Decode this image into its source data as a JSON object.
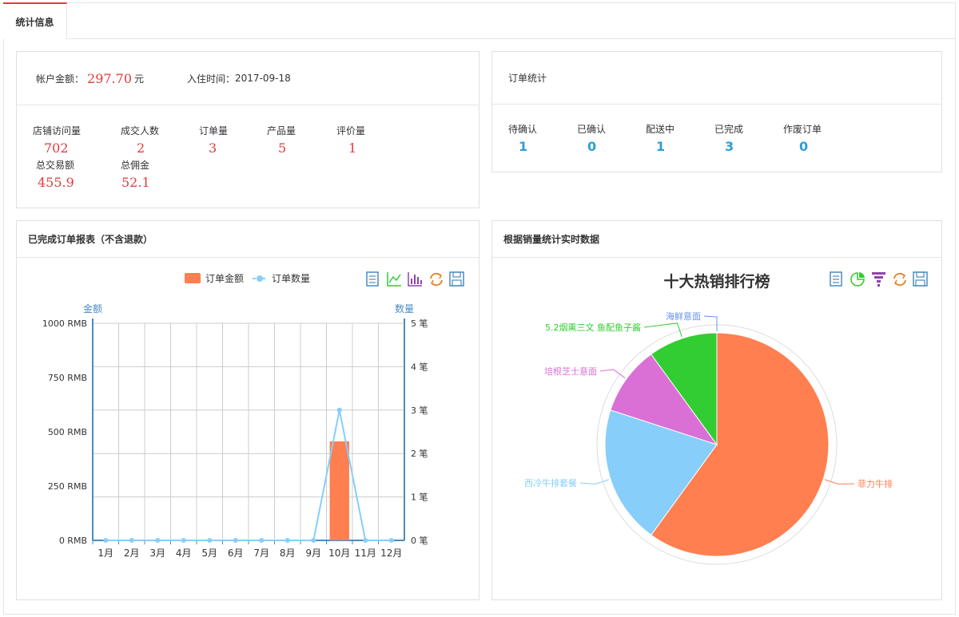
{
  "tab": {
    "label": "统计信息"
  },
  "account": {
    "balance_label": "帐户金额：",
    "balance_value": "297.70",
    "balance_unit": "元",
    "join_label": "入住时间：",
    "join_value": "2017-09-18"
  },
  "shop_stats": [
    {
      "label": "店铺访问量",
      "value": "702"
    },
    {
      "label": "成交人数",
      "value": "2"
    },
    {
      "label": "订单量",
      "value": "3"
    },
    {
      "label": "产品量",
      "value": "5"
    },
    {
      "label": "评价量",
      "value": "1"
    },
    {
      "label": "总交易额",
      "value": "455.9"
    },
    {
      "label": "总佣金",
      "value": "52.1"
    }
  ],
  "order_stats": {
    "title": "订单统计",
    "items": [
      {
        "label": "待确认",
        "value": "1"
      },
      {
        "label": "已确认",
        "value": "0"
      },
      {
        "label": "配送中",
        "value": "1"
      },
      {
        "label": "已完成",
        "value": "3"
      },
      {
        "label": "作废订单",
        "value": "0"
      }
    ]
  },
  "report_panel": {
    "title": "已完成订单报表（不含退款）"
  },
  "sales_panel": {
    "title": "根据销量统计实时数据"
  },
  "colors": {
    "accent": "#e4393c",
    "bar": "#ff7f50",
    "line": "#87cefa",
    "axis": "#4a8bc2"
  },
  "chart_data": [
    {
      "type": "bar",
      "categories": [
        "1月",
        "2月",
        "3月",
        "4月",
        "5月",
        "6月",
        "7月",
        "8月",
        "9月",
        "10月",
        "11月",
        "12月"
      ],
      "series": [
        {
          "name": "订单金额",
          "type": "bar",
          "axis": "left",
          "values": [
            0,
            0,
            0,
            0,
            0,
            0,
            0,
            0,
            0,
            455.9,
            0,
            0
          ]
        },
        {
          "name": "订单数量",
          "type": "line",
          "axis": "right",
          "values": [
            0,
            0,
            0,
            0,
            0,
            0,
            0,
            0,
            0,
            3,
            0,
            0
          ]
        }
      ],
      "ylabel": "金额",
      "y2label": "数量",
      "ylim": [
        0,
        1000
      ],
      "y2lim": [
        0,
        5
      ],
      "yticks": [
        "0 RMB",
        "250 RMB",
        "500 RMB",
        "750 RMB",
        "1000 RMB"
      ],
      "y2ticks": [
        "0 笔",
        "1 笔",
        "2 笔",
        "3 笔",
        "4 笔",
        "5 笔"
      ],
      "grid": true,
      "legend": "top-center"
    },
    {
      "type": "pie",
      "title": "十大热销排行榜",
      "labels": [
        "菲力牛排",
        "西冷牛排套餐",
        "培根芝士意面",
        "5.2烟熏三文 鱼配鱼子酱",
        "海鲜意面"
      ],
      "values": [
        60,
        20,
        10,
        10,
        10
      ],
      "colors": [
        "#ff7f50",
        "#87cefa",
        "#da70d6",
        "#32cd32",
        "#6495ed"
      ],
      "label_colors": [
        "#ff7f50",
        "#87cefa",
        "#da70d6",
        "#32cd32",
        "#6495ed"
      ]
    }
  ]
}
